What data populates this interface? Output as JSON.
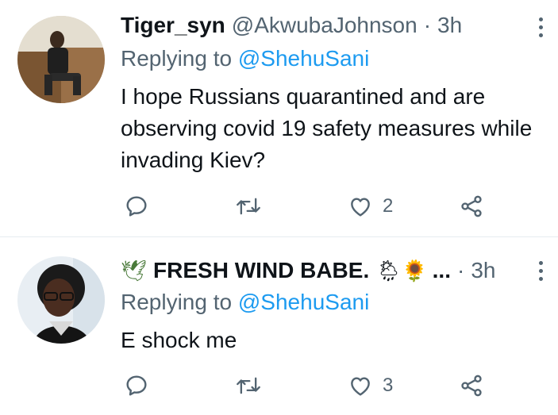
{
  "tweets": [
    {
      "name": "Tiger_syn",
      "handle": "@AkwubaJohnson",
      "separator": "·",
      "time": "3h",
      "replying_prefix": "Replying to",
      "replying_to": "@ShehuSani",
      "text": "I hope Russians quarantined and are observing  covid 19 safety measures while invading Kiev?",
      "like_count": "2"
    },
    {
      "name_prefix_icon": "dove-icon",
      "name": "FRESH WIND BABE.",
      "name_emojis": "🌦🌻",
      "name_ellipsis": "...",
      "separator": "·",
      "time": "3h",
      "replying_prefix": "Replying to",
      "replying_to": "@ShehuSani",
      "text": "E shock me",
      "like_count": "3"
    }
  ],
  "icons": [
    "reply-icon",
    "retweet-icon",
    "like-icon",
    "share-icon",
    "more-icon"
  ],
  "colors": {
    "link": "#1d9bf0",
    "secondary": "#536471",
    "text": "#0f1419",
    "divider": "#e6ecf0"
  }
}
